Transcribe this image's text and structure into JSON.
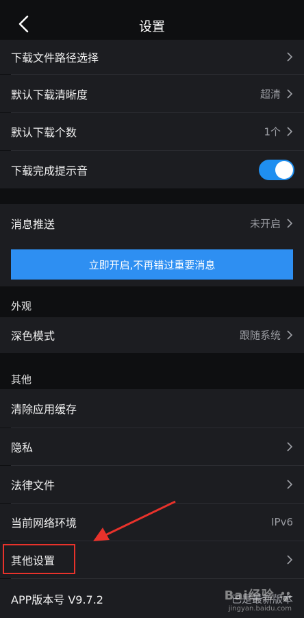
{
  "header": {
    "title": "设置"
  },
  "download": {
    "path_label": "下载文件路径选择",
    "quality_label": "默认下载清晰度",
    "quality_value": "超清",
    "count_label": "默认下载个数",
    "count_value": "1个",
    "sound_label": "下载完成提示音",
    "sound_on": true
  },
  "notify": {
    "label": "消息推送",
    "value": "未开启",
    "cta": "立即开启,不再错过重要消息"
  },
  "appearance": {
    "section": "外观",
    "dark_label": "深色模式",
    "dark_value": "跟随系统"
  },
  "other": {
    "section": "其他",
    "cache_label": "清除应用缓存",
    "privacy_label": "隐私",
    "legal_label": "法律文件",
    "network_label": "当前网络环境",
    "network_value": "IPv6",
    "more_label": "其他设置",
    "version_label": "APP版本号 V9.7.2",
    "version_value": "已是最新版本"
  },
  "watermark": {
    "brand": "Bai经验",
    "url": "jingyan.baidu.com"
  },
  "colors": {
    "accent": "#2e8ff2",
    "annotation": "#e8322b",
    "row_bg": "#1c1d21",
    "page_bg": "#0e0f11"
  }
}
